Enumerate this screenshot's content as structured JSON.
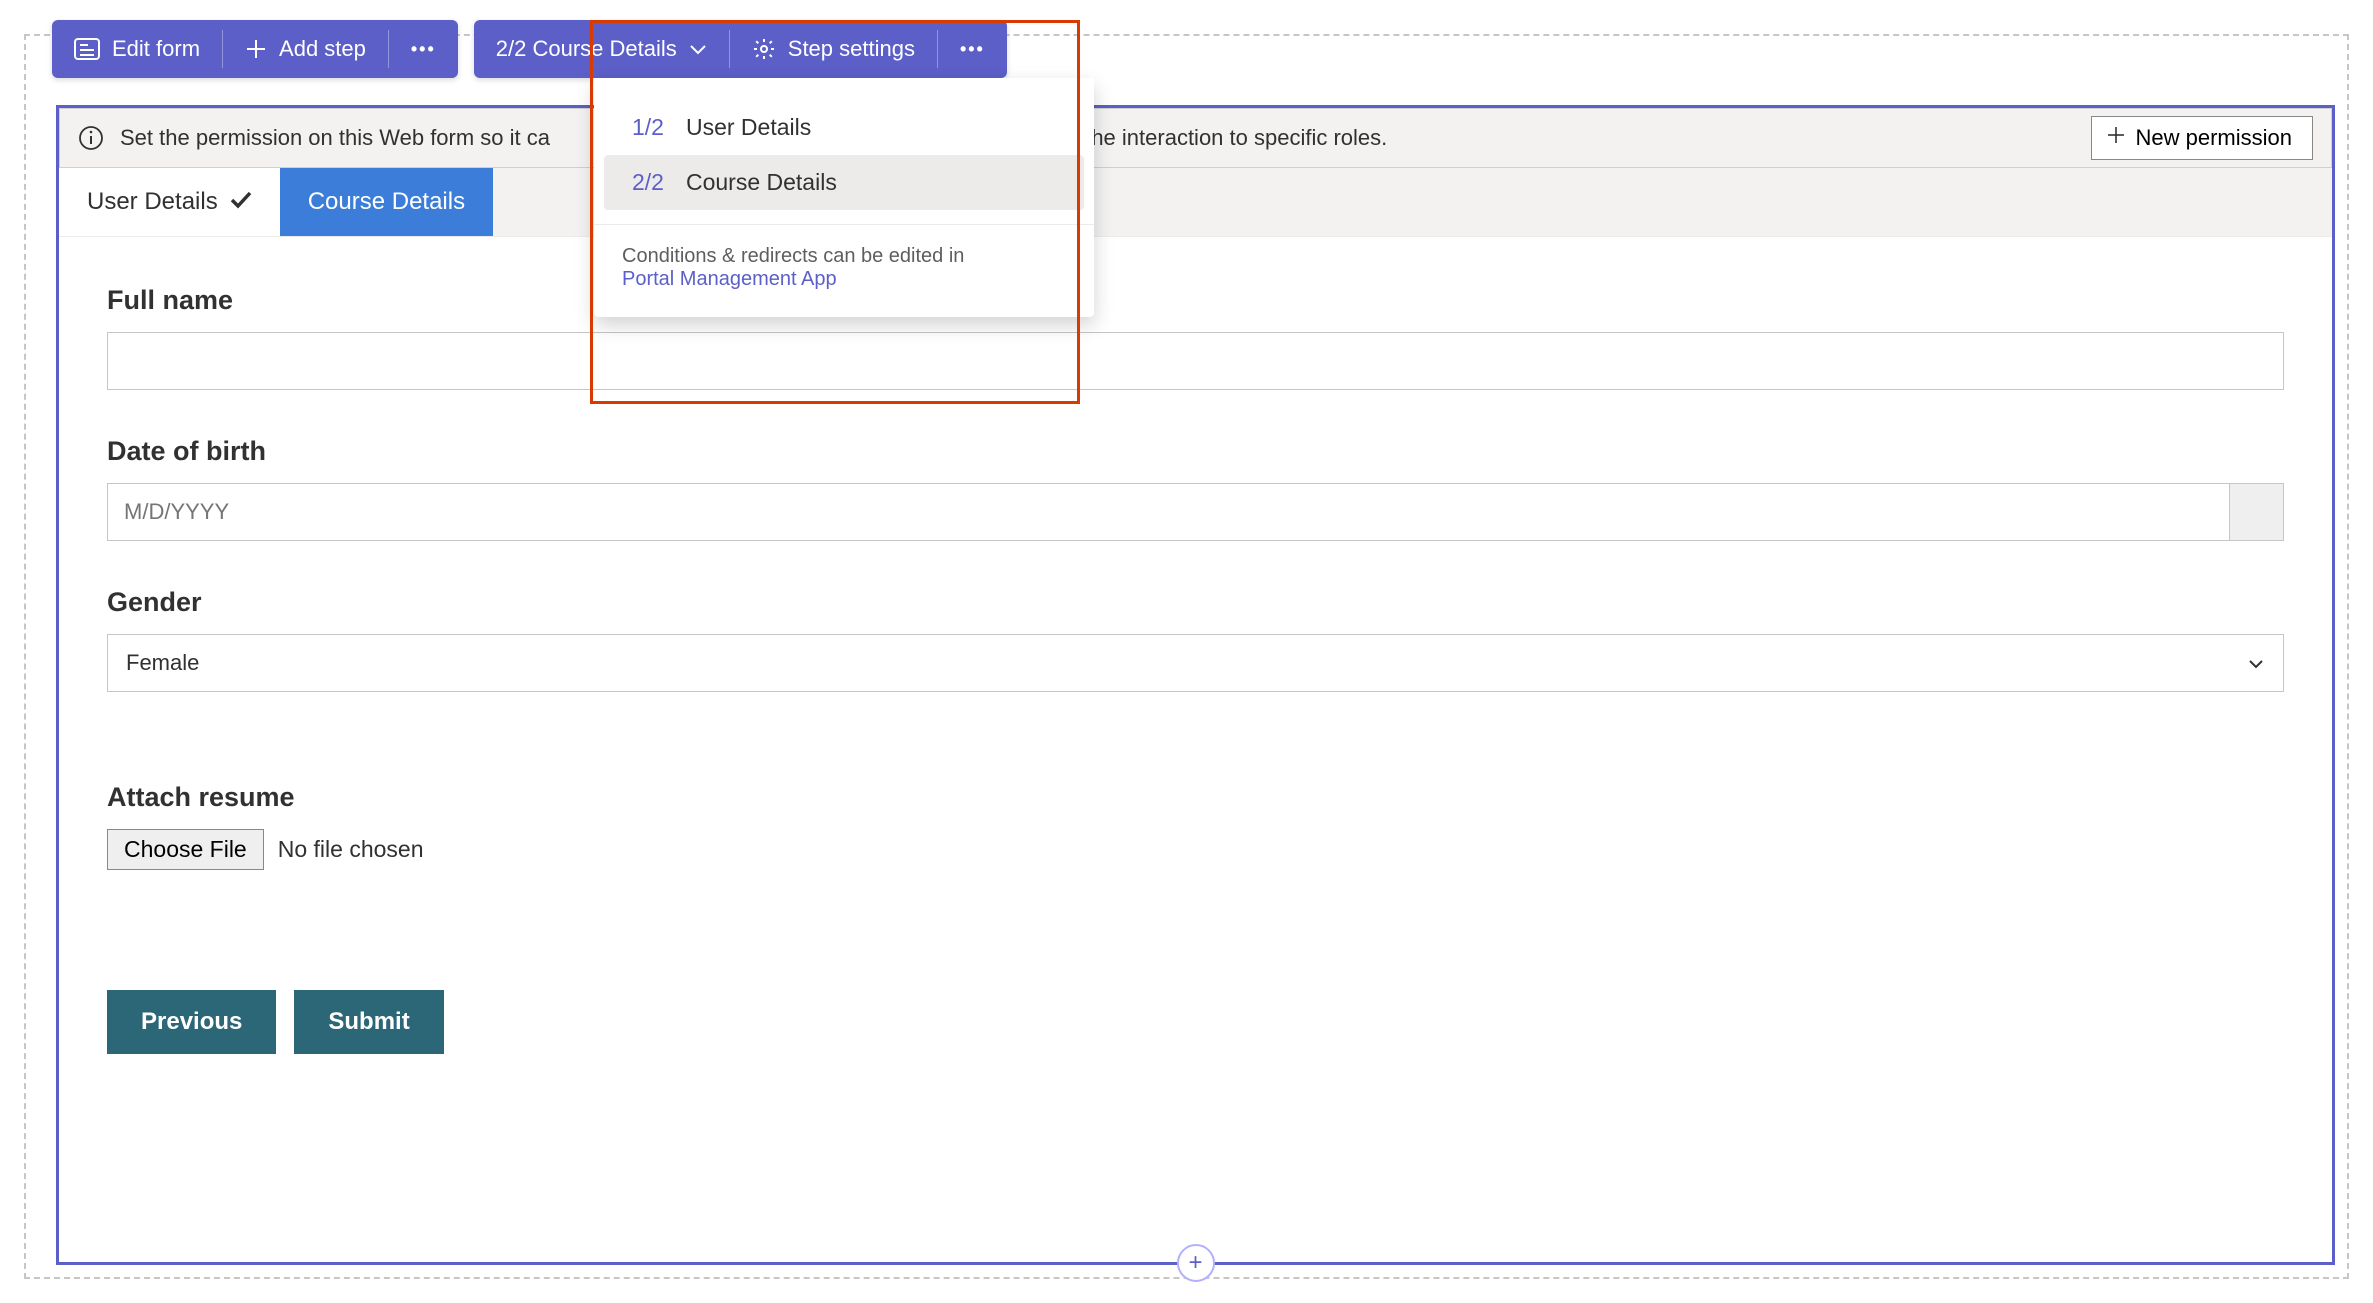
{
  "toolbar_left": {
    "edit_form": "Edit form",
    "add_step": "Add step"
  },
  "toolbar_right": {
    "step_indicator": "2/2 Course Details",
    "step_settings": "Step settings"
  },
  "step_dropdown": {
    "items": [
      {
        "index": "1/2",
        "label": "User Details"
      },
      {
        "index": "2/2",
        "label": "Course Details"
      }
    ],
    "footer_text": "Conditions & redirects can be edited in",
    "footer_link": "Portal Management App"
  },
  "info_bar": {
    "text_left": "Set the permission on this Web form so it ca",
    "text_right": "limit the interaction to specific roles.",
    "new_permission": "New permission"
  },
  "tabs": [
    {
      "label": "User Details",
      "state": "completed"
    },
    {
      "label": "Course Details",
      "state": "active"
    }
  ],
  "form": {
    "full_name_label": "Full name",
    "full_name_value": "",
    "dob_label": "Date of birth",
    "dob_placeholder": "M/D/YYYY",
    "gender_label": "Gender",
    "gender_value": "Female",
    "attach_label": "Attach resume",
    "choose_file": "Choose File",
    "no_file": "No file chosen",
    "previous": "Previous",
    "submit": "Submit"
  }
}
